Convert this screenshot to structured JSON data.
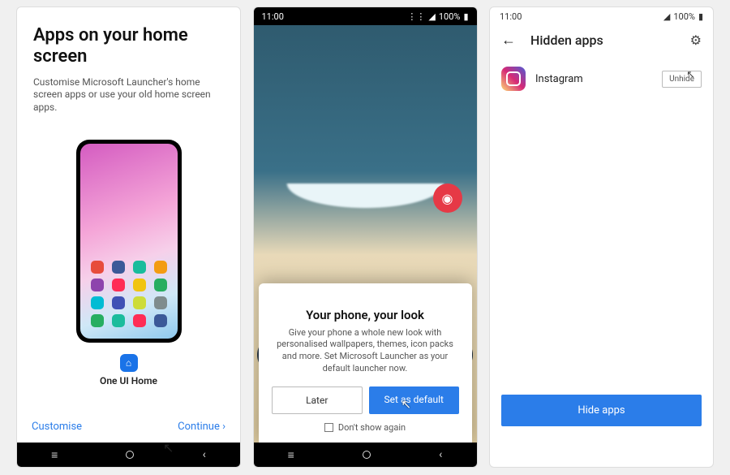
{
  "panel1": {
    "title": "Apps on your home screen",
    "subtitle": "Customise Microsoft Launcher's home screen apps or use your old home screen apps.",
    "launcher_name": "One UI Home",
    "customise": "Customise",
    "continue": "Continue"
  },
  "panel2": {
    "time": "11:00",
    "battery": "100%",
    "sheet_title": "Your phone, your look",
    "sheet_body": "Give your phone a whole new look with personalised wallpapers, themes, icon packs and more. Set Microsoft Launcher as your default launcher now.",
    "later": "Later",
    "set_default": "Set as default",
    "dont_show": "Don't show again"
  },
  "panel3": {
    "time": "11:00",
    "battery": "100%",
    "title": "Hidden apps",
    "app_name": "Instagram",
    "unhide": "Unhide",
    "hide_apps": "Hide apps"
  }
}
